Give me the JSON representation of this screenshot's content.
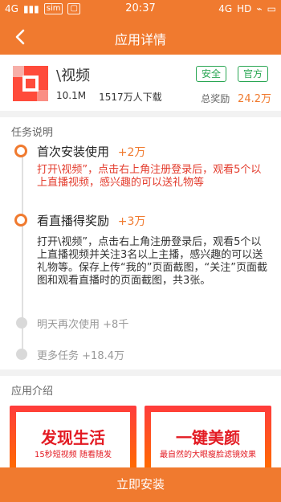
{
  "status_bar": {
    "network_left": "4G",
    "time": "20:37",
    "network_right": "4G",
    "hd": "HD",
    "icons": [
      "signal-icon",
      "wifi-icon",
      "battery-icon"
    ]
  },
  "header": {
    "title": "应用详情"
  },
  "app": {
    "name": "\\视频",
    "size": "10.1M",
    "downloads": "1517万人下载",
    "badge_safe": "安全",
    "badge_official": "官方",
    "reward_label": "总奖励",
    "reward_amount": "24.2万"
  },
  "tasks_section": {
    "title": "任务说明",
    "items": [
      {
        "title": "首次安装使用",
        "amount": "+2万",
        "desc": "打开\\视频”，点击右上角注册登录后，观看5个以上直播视频，感兴趣的可以送礼物等"
      },
      {
        "title": "看直播得奖励",
        "amount": "+3万",
        "desc": "打开\\视频”，点击右上角注册登录后，观看5个以上直播视频并关注3名以上主播，感兴趣的可以送礼物等。保存上传“我的”页面截图，“关注”页面截图和观看直播时的页面截图，共3张。"
      }
    ],
    "locked": [
      {
        "label": "明天再次使用",
        "amount": "+8千"
      },
      {
        "label": "更多任务",
        "amount": "+18.4万"
      }
    ]
  },
  "intro": {
    "title": "应用介绍",
    "shots": [
      {
        "big": "发现生活",
        "small": "15秒短视频 随看随发"
      },
      {
        "big": "一键美颜",
        "small": "最自然的大眼瘦脸滤镜效果"
      }
    ]
  },
  "install_button": {
    "label": "立即安装"
  },
  "colors": {
    "accent": "#f07a2f",
    "green": "#2aa653",
    "red": "#e33c2d"
  }
}
